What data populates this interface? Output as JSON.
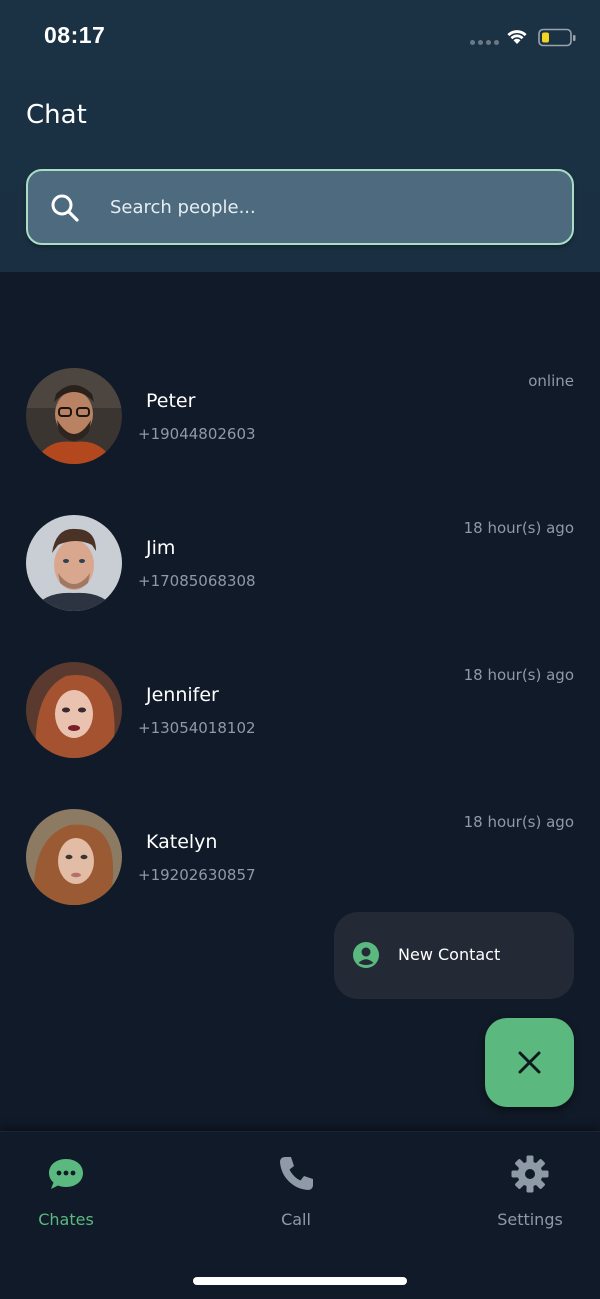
{
  "status_bar": {
    "time": "08:17"
  },
  "header": {
    "title": "Chat",
    "search_placeholder": "Search people..."
  },
  "contacts": [
    {
      "name": "Peter",
      "phone": "+19044802603",
      "last_seen": "online"
    },
    {
      "name": "Jim",
      "phone": "+17085068308",
      "last_seen": "18 hour(s) ago"
    },
    {
      "name": "Jennifer",
      "phone": "+13054018102",
      "last_seen": "18 hour(s) ago"
    },
    {
      "name": "Katelyn",
      "phone": "+19202630857",
      "last_seen": "18 hour(s) ago"
    }
  ],
  "fab_menu": {
    "new_contact_label": "New Contact",
    "new_contact_icon": "person-icon",
    "close_icon": "close-icon"
  },
  "bottom_nav": [
    {
      "label": "Chates",
      "icon": "chat-bubble-icon",
      "active": true
    },
    {
      "label": "Call",
      "icon": "phone-icon",
      "active": false
    },
    {
      "label": "Settings",
      "icon": "gear-icon",
      "active": false
    }
  ],
  "colors": {
    "accent": "#5bb97f",
    "background": "#111a28",
    "header": "#1b3144",
    "inactive": "#8e9aa6"
  }
}
